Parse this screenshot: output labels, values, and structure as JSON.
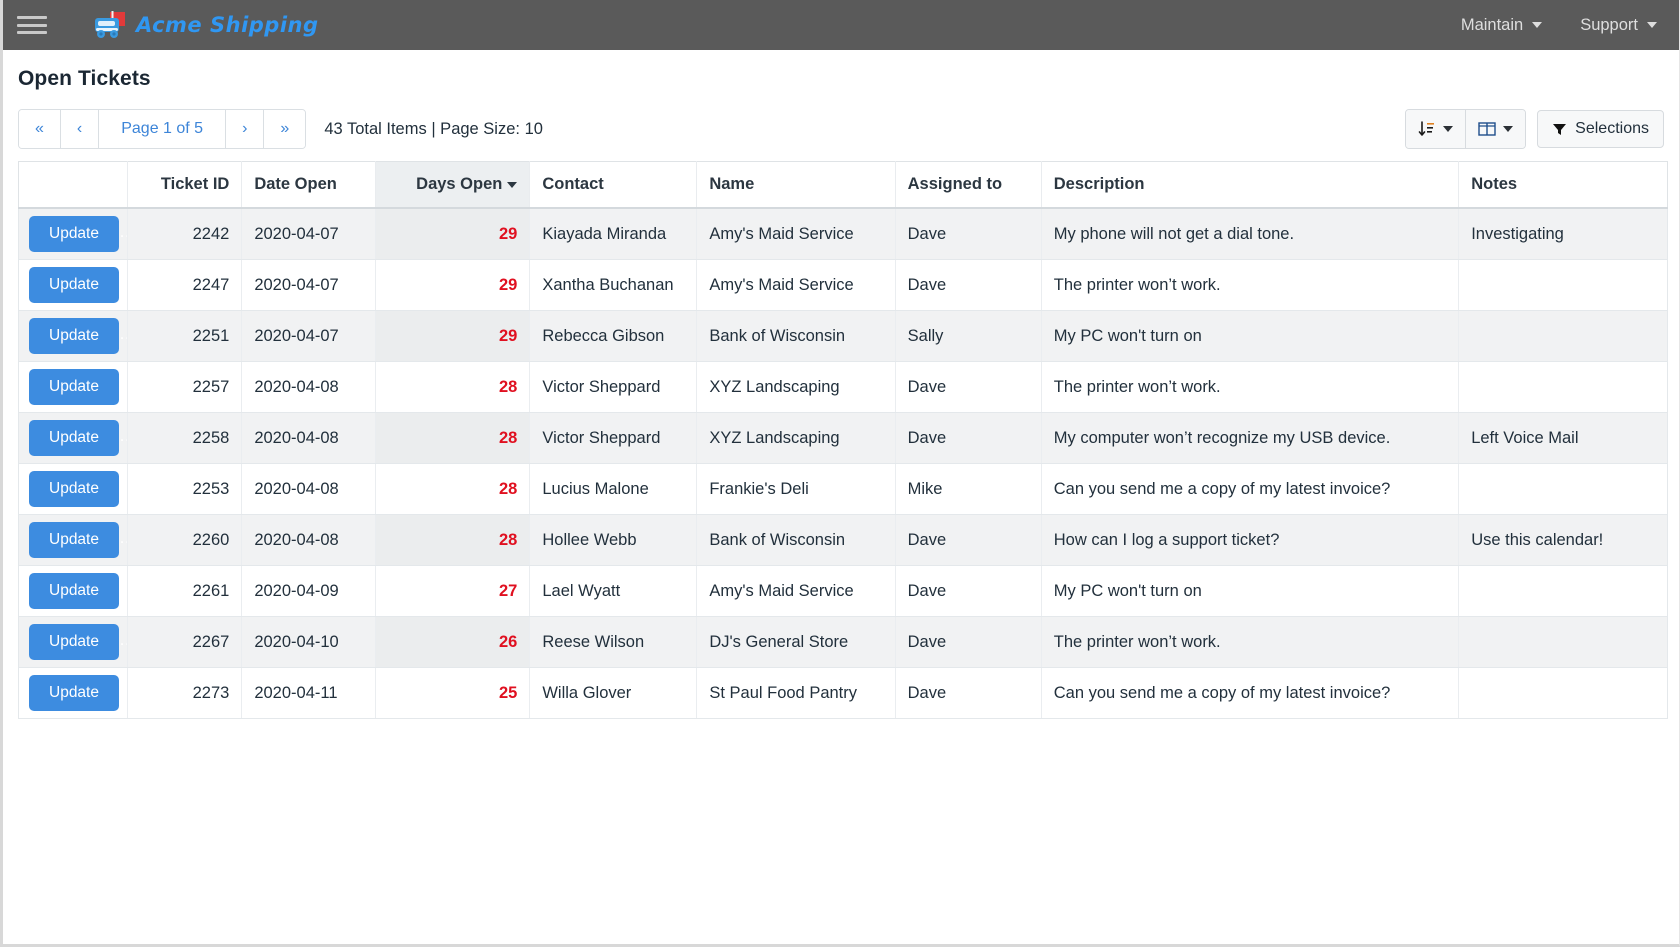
{
  "navbar": {
    "menu_icon": "hamburger-icon",
    "brand": "Acme Shipping",
    "brand_icon": "truck-icon",
    "brand_color": "#3097f2",
    "bar_color": "#5a5a5a",
    "links": [
      {
        "label": "Maintain"
      },
      {
        "label": "Support"
      }
    ]
  },
  "page": {
    "title": "Open Tickets"
  },
  "toolbar": {
    "pager": {
      "first_label": "«",
      "prev_label": "‹",
      "page_label": "Page 1 of 5",
      "next_label": "›",
      "last_label": "»"
    },
    "summary": "43 Total Items | Page Size: 10",
    "sort_button": {
      "icon": "sort-icon"
    },
    "columns_button": {
      "icon": "columns-icon"
    },
    "selections_button": {
      "label": "Selections",
      "icon": "filter-icon"
    }
  },
  "table": {
    "columns": [
      {
        "key": "action",
        "label": "",
        "align": "left"
      },
      {
        "key": "ticket_id",
        "label": "Ticket ID",
        "align": "right"
      },
      {
        "key": "date_open",
        "label": "Date Open",
        "align": "left"
      },
      {
        "key": "days_open",
        "label": "Days Open",
        "align": "right",
        "sorted": true,
        "sort_dir": "desc"
      },
      {
        "key": "contact",
        "label": "Contact",
        "align": "left"
      },
      {
        "key": "name",
        "label": "Name",
        "align": "left"
      },
      {
        "key": "assigned_to",
        "label": "Assigned to",
        "align": "left"
      },
      {
        "key": "description",
        "label": "Description",
        "align": "left"
      },
      {
        "key": "notes",
        "label": "Notes",
        "align": "left"
      }
    ],
    "row_action_label": "Update",
    "days_open_color": "#e01020",
    "rows": [
      {
        "ticket_id": "2242",
        "date_open": "2020-04-07",
        "days_open": "29",
        "contact": "Kiayada Miranda",
        "name": "Amy's Maid Service",
        "assigned_to": "Dave",
        "description": "My phone will not get a dial tone.",
        "notes": "Investigating"
      },
      {
        "ticket_id": "2247",
        "date_open": "2020-04-07",
        "days_open": "29",
        "contact": "Xantha Buchanan",
        "name": "Amy's Maid Service",
        "assigned_to": "Dave",
        "description": "The printer won’t work.",
        "notes": ""
      },
      {
        "ticket_id": "2251",
        "date_open": "2020-04-07",
        "days_open": "29",
        "contact": "Rebecca Gibson",
        "name": "Bank of Wisconsin",
        "assigned_to": "Sally",
        "description": "My PC won't turn on",
        "notes": ""
      },
      {
        "ticket_id": "2257",
        "date_open": "2020-04-08",
        "days_open": "28",
        "contact": "Victor Sheppard",
        "name": "XYZ Landscaping",
        "assigned_to": "Dave",
        "description": "The printer won’t work.",
        "notes": ""
      },
      {
        "ticket_id": "2258",
        "date_open": "2020-04-08",
        "days_open": "28",
        "contact": "Victor Sheppard",
        "name": "XYZ Landscaping",
        "assigned_to": "Dave",
        "description": "My computer won’t recognize my USB device.",
        "notes": "Left Voice Mail"
      },
      {
        "ticket_id": "2253",
        "date_open": "2020-04-08",
        "days_open": "28",
        "contact": "Lucius Malone",
        "name": "Frankie's Deli",
        "assigned_to": "Mike",
        "description": "Can you send me a copy of my latest invoice?",
        "notes": ""
      },
      {
        "ticket_id": "2260",
        "date_open": "2020-04-08",
        "days_open": "28",
        "contact": "Hollee Webb",
        "name": "Bank of Wisconsin",
        "assigned_to": "Dave",
        "description": "How can I log a support ticket?",
        "notes": "Use this calendar!"
      },
      {
        "ticket_id": "2261",
        "date_open": "2020-04-09",
        "days_open": "27",
        "contact": "Lael Wyatt",
        "name": "Amy's Maid Service",
        "assigned_to": "Dave",
        "description": "My PC won't turn on",
        "notes": ""
      },
      {
        "ticket_id": "2267",
        "date_open": "2020-04-10",
        "days_open": "26",
        "contact": "Reese Wilson",
        "name": "DJ's General Store",
        "assigned_to": "Dave",
        "description": "The printer won’t work.",
        "notes": ""
      },
      {
        "ticket_id": "2273",
        "date_open": "2020-04-11",
        "days_open": "25",
        "contact": "Willa Glover",
        "name": "St Paul Food Pantry",
        "assigned_to": "Dave",
        "description": "Can you send me a copy of my latest invoice?",
        "notes": ""
      }
    ]
  }
}
